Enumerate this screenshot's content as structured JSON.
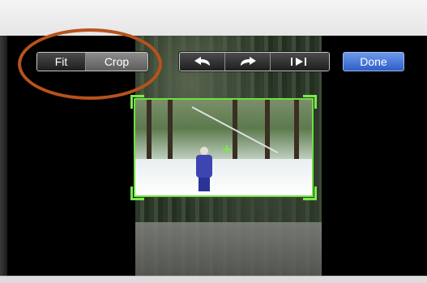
{
  "toolbar": {
    "fit_label": "Fit",
    "crop_label": "Crop",
    "rotate_left_icon": "rotate-left-icon",
    "rotate_right_icon": "rotate-right-icon",
    "play_icon": "play-to-end-icon",
    "done_label": "Done"
  },
  "colors": {
    "crop_outline": "#6fe03c",
    "done_button": "#3f6fdc",
    "annotation_ring": "#b8521c"
  }
}
